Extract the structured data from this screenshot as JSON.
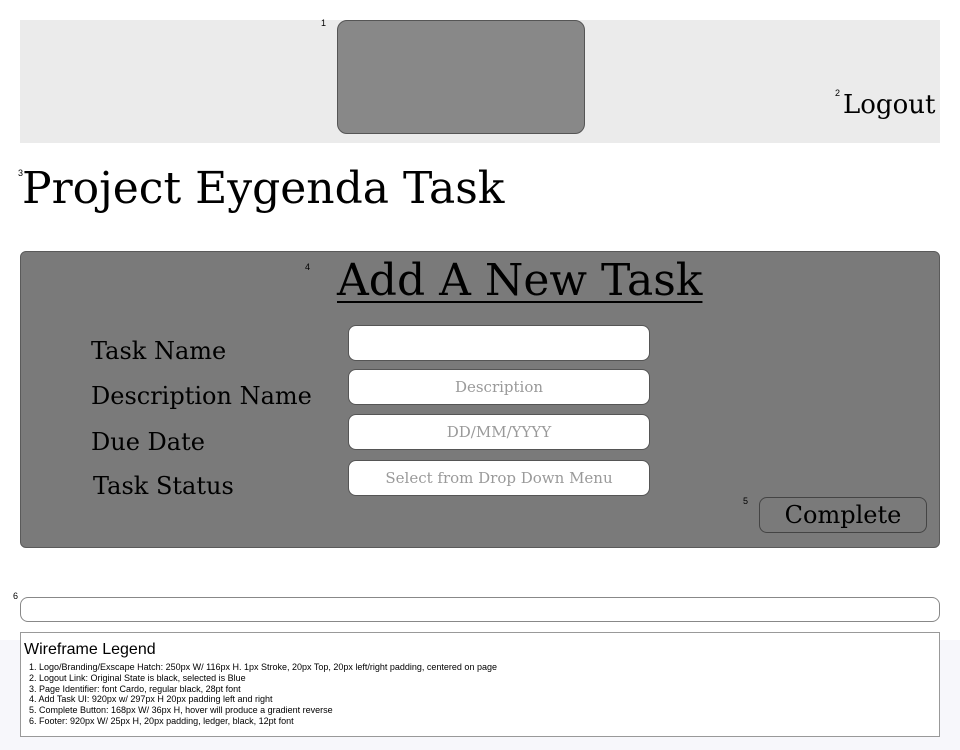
{
  "markers": {
    "m1": "1",
    "m2": "2",
    "m3": "3",
    "m4": "4",
    "m5": "5",
    "m6": "6"
  },
  "header": {
    "logout_label": "Logout"
  },
  "page": {
    "title": "Project Eygenda Task"
  },
  "task_form": {
    "title": "Add A New Task",
    "fields": [
      {
        "label": "Task Name",
        "value": "",
        "placeholder": ""
      },
      {
        "label": "Description Name",
        "value": "",
        "placeholder": "Description"
      },
      {
        "label": "Due Date",
        "value": "",
        "placeholder": "DD/MM/YYYY"
      },
      {
        "label": "Task Status",
        "value": "",
        "placeholder": "Select from Drop Down Menu"
      }
    ],
    "complete_label": "Complete"
  },
  "legend": {
    "title": "Wireframe Legend",
    "items": [
      "1. Logo/Branding/Exscape Hatch: 250px W/ 116px H. 1px Stroke, 20px Top, 20px left/right padding, centered on page",
      "2. Logout Link: Original State is black, selected is Blue",
      "3. Page Identifier: font Cardo, regular black, 28pt font",
      "4. Add Task UI: 920px w/ 297px H 20px padding left and right",
      "5. Complete Button: 168px W/ 36px H, hover will produce a gradient reverse",
      "6. Footer: 920px W/ 25px H, 20px padding, ledger, black, 12pt font"
    ]
  },
  "colors": {
    "header_bg": "#ebebeb",
    "logo_bg": "#888888",
    "panel_bg": "#7a7a7a"
  }
}
